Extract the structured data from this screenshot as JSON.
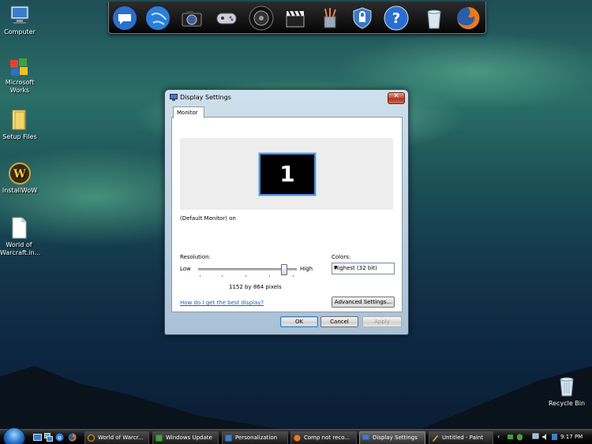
{
  "desktop": {
    "icons": [
      {
        "label": "Computer"
      },
      {
        "label": "Microsoft Works"
      },
      {
        "label": "Setup Files"
      },
      {
        "label": "InstallWoW"
      },
      {
        "label": "World of Warcraft.in..."
      },
      {
        "label": "Recycle Bin"
      }
    ]
  },
  "dock": {
    "items": [
      {
        "icon": "messenger-icon"
      },
      {
        "icon": "globe-icon"
      },
      {
        "icon": "camera-icon"
      },
      {
        "icon": "gamepad-icon"
      },
      {
        "icon": "speaker-icon"
      },
      {
        "icon": "clapperboard-icon"
      },
      {
        "icon": "pencil-cup-icon"
      },
      {
        "icon": "shield-icon"
      },
      {
        "icon": "help-icon"
      },
      {
        "icon": "trash-icon"
      },
      {
        "icon": "firefox-icon"
      }
    ]
  },
  "dialog": {
    "title": "Display Settings",
    "tab_label": "Monitor",
    "monitor_number": "1",
    "monitor_caption": "(Default Monitor) on",
    "resolution": {
      "label": "Resolution:",
      "low_label": "Low",
      "high_label": "High",
      "value_text": "1152 by 864 pixels",
      "slider_position": 0.9
    },
    "colors": {
      "label": "Colors:",
      "selected": "Highest (32 bit)"
    },
    "help_link": "How do I get the best display?",
    "buttons": {
      "advanced": "Advanced Settings...",
      "ok": "OK",
      "cancel": "Cancel",
      "apply": "Apply"
    }
  },
  "taskbar": {
    "tasks": [
      {
        "label": "World of Warcr..."
      },
      {
        "label": "Windows Update"
      },
      {
        "label": "Personalization"
      },
      {
        "label": "Comp not reco..."
      },
      {
        "label": "Display Settings"
      },
      {
        "label": "Untitled - Paint"
      }
    ],
    "clock": "9:17 PM"
  },
  "colors": {
    "dialog_accent": "#4a90e2",
    "link": "#1a5fb4",
    "close_button": "#c24a32"
  }
}
